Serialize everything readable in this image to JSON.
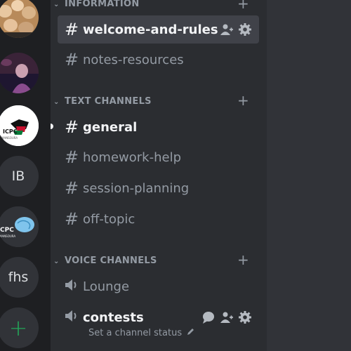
{
  "servers": [
    {
      "type": "image",
      "name": "group-photo-server"
    },
    {
      "type": "image",
      "name": "photo-server"
    },
    {
      "type": "image",
      "name": "icpc-palestine-server",
      "label": "ICPC MANSOURA"
    },
    {
      "type": "text",
      "label": "IB"
    },
    {
      "type": "image",
      "name": "icpc-brain-server",
      "label": "ICPC MANSOURA"
    },
    {
      "type": "text",
      "label": "fhs"
    },
    {
      "type": "add",
      "label": "+"
    }
  ],
  "categories": {
    "information": "INFORMATION",
    "text": "TEXT CHANNELS",
    "voice": "VOICE CHANNELS"
  },
  "channels": {
    "welcome": "welcome-and-rules",
    "notes": "notes-resources",
    "general": "general",
    "homework": "homework-help",
    "session": "session-planning",
    "offtopic": "off-topic",
    "lounge": "Lounge",
    "contests": "contests"
  },
  "contests_status": "Set a channel status",
  "colors": {
    "rail_bg": "#1e1f22",
    "sidebar_bg": "#2b2d31",
    "main_bg": "#313338",
    "selected_bg": "#404249",
    "muted_text": "#949ba4",
    "bright_text": "#f2f3f5",
    "add_green": "#23a559"
  }
}
